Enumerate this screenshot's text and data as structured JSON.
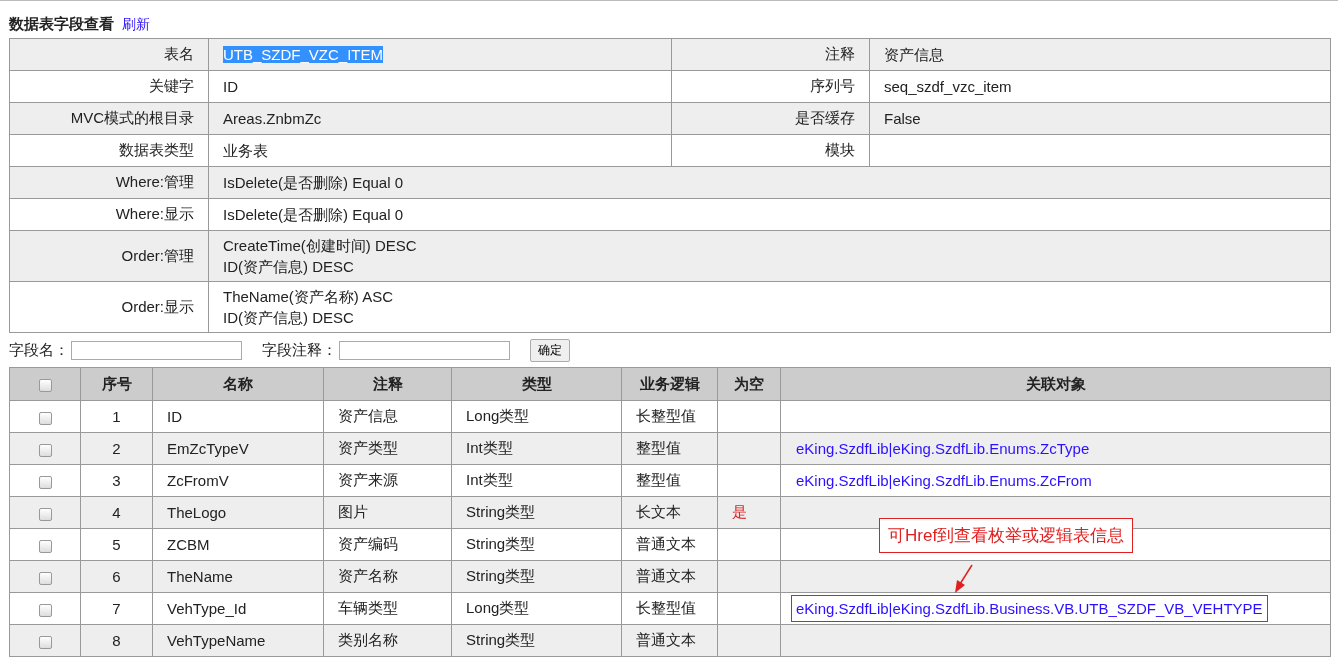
{
  "header": {
    "title": "数据表字段查看",
    "refresh_link": "刷新"
  },
  "info": {
    "rows": [
      {
        "cells": [
          {
            "label": "表名",
            "value": [
              "UTB_SZDF_VZC_ITEM"
            ],
            "highlighted": true
          },
          {
            "label": "注释",
            "value": [
              "资产信息"
            ]
          }
        ]
      },
      {
        "cells": [
          {
            "label": "关键字",
            "value": [
              "ID"
            ]
          },
          {
            "label": "序列号",
            "value": [
              "seq_szdf_vzc_item"
            ]
          }
        ]
      },
      {
        "cells": [
          {
            "label": "MVC模式的根目录",
            "value": [
              "Areas.ZnbmZc"
            ]
          },
          {
            "label": "是否缓存",
            "value": [
              "False"
            ]
          }
        ]
      },
      {
        "cells": [
          {
            "label": "数据表类型",
            "value": [
              "业务表"
            ]
          },
          {
            "label": "模块"
          }
        ]
      },
      {
        "cells": [
          {
            "label": "Where:管理",
            "value": [
              "IsDelete(是否删除) Equal 0"
            ]
          }
        ]
      },
      {
        "cells": [
          {
            "label": "Where:显示",
            "value": [
              "IsDelete(是否删除) Equal 0"
            ]
          }
        ]
      },
      {
        "cells": [
          {
            "label": "Order:管理",
            "value": [
              "CreateTime(创建时间) DESC",
              "ID(资产信息) DESC"
            ]
          }
        ]
      },
      {
        "cells": [
          {
            "label": "Order:显示",
            "value": [
              "TheName(资产名称) ASC",
              "ID(资产信息) DESC"
            ]
          }
        ]
      }
    ]
  },
  "filter": {
    "field_name_label": "字段名：",
    "field_comment_label": "字段注释：",
    "confirm_button": "确定"
  },
  "fields": {
    "header_checked": false,
    "columns": [
      "序号",
      "名称",
      "注释",
      "类型",
      "业务逻辑",
      "为空",
      "关联对象"
    ],
    "rows": [
      {
        "checked": false,
        "no": "1",
        "name": "ID",
        "comment": "资产信息",
        "type": "Long类型",
        "logic": "长整型值"
      },
      {
        "checked": false,
        "no": "2",
        "name": "EmZcTypeV",
        "comment": "资产类型",
        "type": "Int类型",
        "logic": "整型值",
        "link": "eKing.SzdfLib|eKing.SzdfLib.Enums.ZcType"
      },
      {
        "checked": false,
        "no": "3",
        "name": "ZcFromV",
        "comment": "资产来源",
        "type": "Int类型",
        "logic": "整型值",
        "link": "eKing.SzdfLib|eKing.SzdfLib.Enums.ZcFrom"
      },
      {
        "checked": false,
        "no": "4",
        "name": "TheLogo",
        "comment": "图片",
        "type": "String类型",
        "logic": "长文本",
        "nullable": "是"
      },
      {
        "checked": false,
        "no": "5",
        "name": "ZCBM",
        "comment": "资产编码",
        "type": "String类型",
        "logic": "普通文本"
      },
      {
        "checked": false,
        "no": "6",
        "name": "TheName",
        "comment": "资产名称",
        "type": "String类型",
        "logic": "普通文本"
      },
      {
        "checked": false,
        "no": "7",
        "name": "VehType_Id",
        "comment": "车辆类型",
        "type": "Long类型",
        "logic": "长整型值",
        "link": "eKing.SzdfLib|eKing.SzdfLib.Business.VB.UTB_SZDF_VB_VEHTYPE",
        "boxed": true
      },
      {
        "checked": false,
        "no": "8",
        "name": "VehTypeName",
        "comment": "类别名称",
        "type": "String类型",
        "logic": "普通文本"
      }
    ]
  },
  "annotation": {
    "text": "可Href到查看枚举或逻辑表信息"
  }
}
